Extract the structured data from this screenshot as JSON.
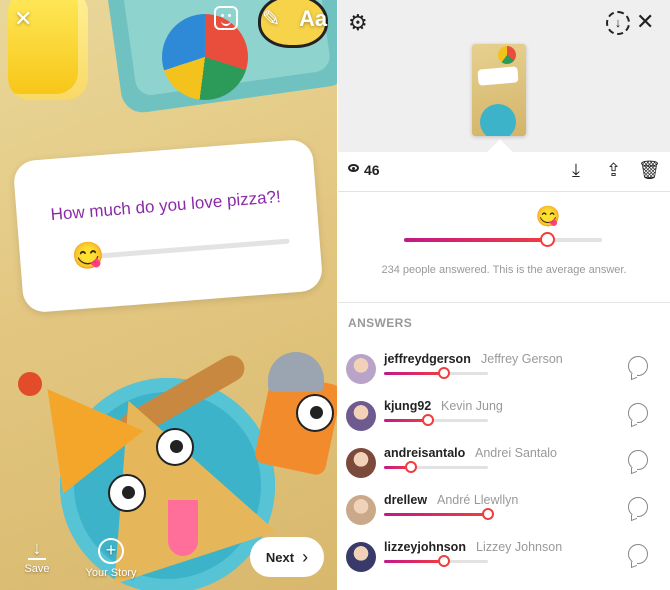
{
  "composer": {
    "text_tool_label": "Aa",
    "slider_question": "How much do you love pizza?!",
    "slider_emoji": "😋",
    "save_label": "Save",
    "your_story_label": "Your Story",
    "next_label": "Next"
  },
  "results": {
    "view_count": "46",
    "average_emoji": "😋",
    "average_value": 0.72,
    "caption": "234 people answered. This is the average answer.",
    "answers_heading": "ANSWERS",
    "answers": [
      {
        "username": "jeffreydgerson",
        "full_name": "Jeffrey Gerson",
        "value": 0.58
      },
      {
        "username": "kjung92",
        "full_name": "Kevin Jung",
        "value": 0.42
      },
      {
        "username": "andreisantalo",
        "full_name": "Andrei Santalo",
        "value": 0.26
      },
      {
        "username": "drellew",
        "full_name": "André Llewllyn",
        "value": 1.0
      },
      {
        "username": "lizzeyjohnson",
        "full_name": "Lizzey Johnson",
        "value": 0.58
      }
    ],
    "avatar_colors": [
      "#b9a3c9",
      "#6f5a8f",
      "#7b4a3a",
      "#c9a98a",
      "#3a3a6a"
    ]
  },
  "colors": {
    "accent_start": "#c2188a",
    "accent_end": "#f03d3d",
    "question_text": "#8b2aa6"
  }
}
